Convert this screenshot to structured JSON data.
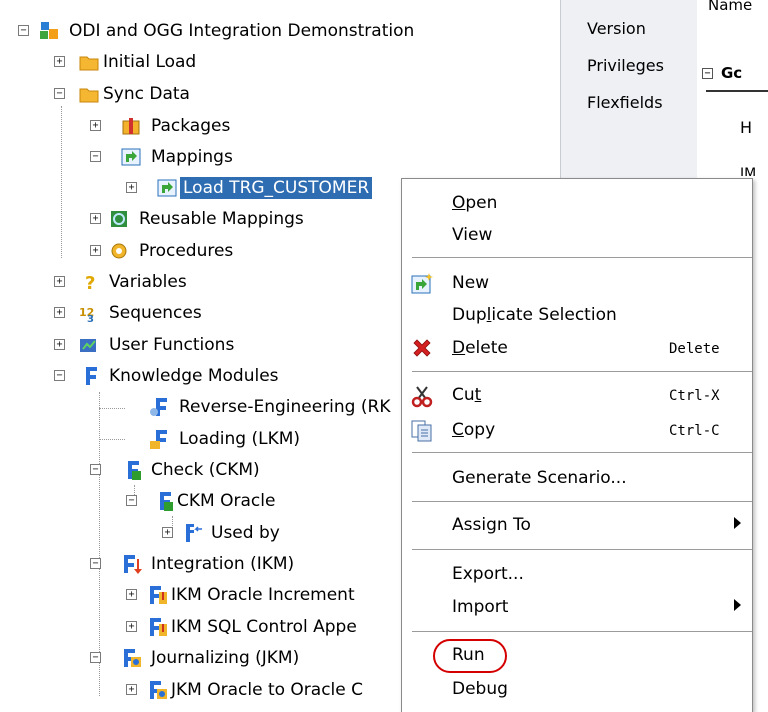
{
  "tree": {
    "root": "ODI and OGG Integration Demonstration",
    "initial_load": "Initial Load",
    "sync_data": "Sync Data",
    "packages": "Packages",
    "mappings": "Mappings",
    "load_trg_customer": "Load TRG_CUSTOMER",
    "reusable_mappings": "Reusable Mappings",
    "procedures": "Procedures",
    "variables": "Variables",
    "sequences": "Sequences",
    "user_functions": "User Functions",
    "knowledge_modules": "Knowledge Modules",
    "rkm": "Reverse-Engineering (RK",
    "lkm": "Loading (LKM)",
    "ckm": "Check (CKM)",
    "ckm_oracle": "CKM Oracle",
    "used_by": "Used by",
    "ikm": "Integration (IKM)",
    "ikm_incr": "IKM Oracle Increment",
    "ikm_sql": "IKM SQL Control Appe",
    "jkm": "Journalizing (JKM)",
    "jkm_oracle": "JKM Oracle to Oracle C"
  },
  "properties": {
    "nav_version": "Version",
    "nav_privileges": "Privileges",
    "nav_flexfields": "Flexfields",
    "name_label": "Name",
    "section_label": "Gc",
    "h_label": "H",
    "partial_label": "IM"
  },
  "context_menu": {
    "open": {
      "pre": "",
      "u": "O",
      "post": "pen"
    },
    "view": "View",
    "new": "New",
    "duplicate": {
      "pre": "Dup",
      "u": "l",
      "post": "icate Selection"
    },
    "delete": {
      "pre": "",
      "u": "D",
      "post": "elete"
    },
    "delete_shortcut": "Delete",
    "cut": {
      "pre": "Cu",
      "u": "t",
      "post": ""
    },
    "cut_shortcut": "Ctrl-X",
    "copy": {
      "pre": "",
      "u": "C",
      "post": "opy"
    },
    "copy_shortcut": "Ctrl-C",
    "generate_scenario": "Generate Scenario...",
    "assign_to": "Assign To",
    "export": "Export...",
    "import": "Import",
    "run": "Run",
    "debug": "Debug"
  },
  "colors": {
    "selection": "#2f6db2",
    "highlight_circle": "#d40000"
  }
}
